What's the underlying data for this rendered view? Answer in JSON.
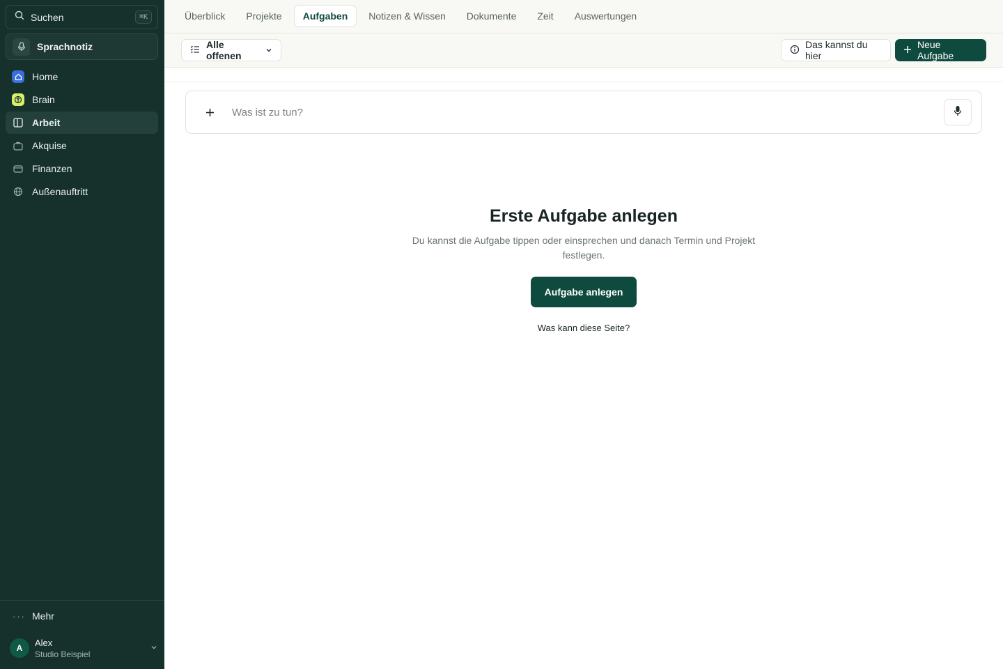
{
  "sidebar": {
    "search": {
      "label": "Suchen",
      "shortcut": "⌘K"
    },
    "voice_note": {
      "label": "Sprachnotiz"
    },
    "items": [
      {
        "label": "Home",
        "icon": "home-icon"
      },
      {
        "label": "Brain",
        "icon": "brain-icon"
      },
      {
        "label": "Arbeit",
        "icon": "columns-icon"
      },
      {
        "label": "Akquise",
        "icon": "briefcase-icon"
      },
      {
        "label": "Finanzen",
        "icon": "wallet-icon"
      },
      {
        "label": "Außenauftritt",
        "icon": "globe-icon"
      }
    ],
    "active_item": "Arbeit",
    "more": {
      "label": "Mehr",
      "dots": "···"
    },
    "user": {
      "initial": "A",
      "name": "Alex",
      "org": "Studio Beispiel"
    }
  },
  "tabs": [
    "Überblick",
    "Projekte",
    "Aufgaben",
    "Notizen & Wissen",
    "Dokumente",
    "Zeit",
    "Auswertungen"
  ],
  "active_tab": "Aufgaben",
  "toolbar": {
    "filter_label": "Alle offenen",
    "help_label": "Das kannst du hier",
    "new_label": "Neue Aufgabe"
  },
  "quick_add": {
    "placeholder": "Was ist zu tun?"
  },
  "empty_state": {
    "title": "Erste Aufgabe anlegen",
    "description": "Du kannst die Aufgabe tippen oder einsprechen und danach Termin und Projekt festlegen.",
    "cta_label": "Aufgabe anlegen",
    "link_label": "Was kann diese Seite?"
  },
  "colors": {
    "sidebar_bg": "#16302b",
    "accent": "#0f4a3e",
    "home_icon_bg": "#3b6fe0",
    "brain_icon_bg": "#d7f06a"
  }
}
